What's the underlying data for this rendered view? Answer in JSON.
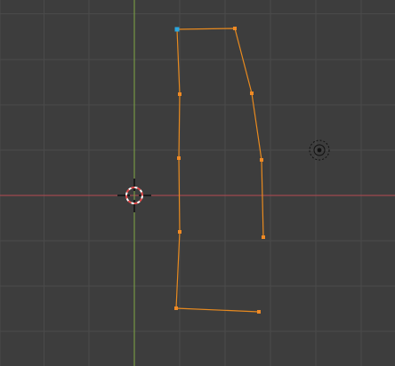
{
  "viewport": {
    "mode": "edit",
    "grid_visible": true,
    "axes": [
      "x-axis",
      "y-axis"
    ]
  },
  "colors": {
    "background": "#3d3d3d",
    "grid": "#4a4a4a",
    "x_axis": "#b74a52",
    "y_axis": "#7ea845",
    "curve": "#e88a1f",
    "vertex": "#f08a24",
    "active_vertex": "#2aa7e0",
    "cursor_ring_red": "#e24a4a",
    "cursor_ring_white": "#ffffff",
    "cursor_lines": "#111111",
    "light_icon": "#111111"
  },
  "curve": {
    "vertex_count": 11,
    "active_vertex_index": 0
  },
  "icons": {
    "cursor": "3d-cursor-icon",
    "light": "light-source-icon"
  }
}
